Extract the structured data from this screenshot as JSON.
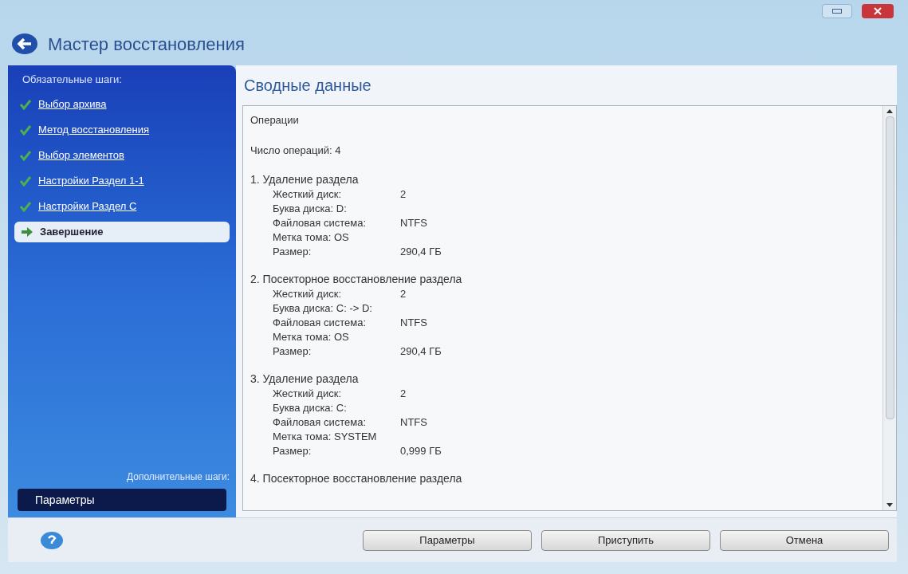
{
  "window": {
    "title": "Мастер восстановления"
  },
  "sidebar": {
    "required_heading": "Обязательные шаги:",
    "steps": [
      {
        "label": "Выбор архива",
        "done": true,
        "selected": false
      },
      {
        "label": "Метод восстановления",
        "done": true,
        "selected": false
      },
      {
        "label": "Выбор элементов",
        "done": true,
        "selected": false
      },
      {
        "label": "Настройки Раздел 1-1",
        "done": true,
        "selected": false
      },
      {
        "label": "Настройки Раздел C",
        "done": true,
        "selected": false
      },
      {
        "label": "Завершение",
        "done": false,
        "selected": true
      }
    ],
    "optional_heading": "Дополнительные шаги:",
    "options_button": "Параметры"
  },
  "main": {
    "heading": "Сводные данные",
    "summary": {
      "heading": "Операции",
      "count": "Число операций: 4",
      "operations": [
        {
          "title": "1. Удаление раздела",
          "fields": [
            {
              "label": "Жесткий диск:",
              "value": "2"
            },
            {
              "label": "Буква диска: D:"
            },
            {
              "label": "Файловая система:",
              "value": "NTFS"
            },
            {
              "label": "Метка тома: OS"
            },
            {
              "label": "Размер:",
              "value": "290,4 ГБ"
            }
          ]
        },
        {
          "title": "2. Посекторное восстановление раздела",
          "fields": [
            {
              "label": "Жесткий диск:",
              "value": "2"
            },
            {
              "label": "Буква диска: C: -> D:"
            },
            {
              "label": "Файловая система:",
              "value": "NTFS"
            },
            {
              "label": "Метка тома: OS"
            },
            {
              "label": "Размер:",
              "value": "290,4 ГБ"
            }
          ]
        },
        {
          "title": "3. Удаление раздела",
          "fields": [
            {
              "label": "Жесткий диск:",
              "value": "2"
            },
            {
              "label": "Буква диска: C:"
            },
            {
              "label": "Файловая система:",
              "value": "NTFS"
            },
            {
              "label": "Метка тома: SYSTEM"
            },
            {
              "label": "Размер:",
              "value": "0,999 ГБ"
            }
          ]
        },
        {
          "title": "4. Посекторное восстановление раздела"
        }
      ]
    }
  },
  "buttons": [
    "Параметры",
    "Приступить",
    "Отмена"
  ]
}
